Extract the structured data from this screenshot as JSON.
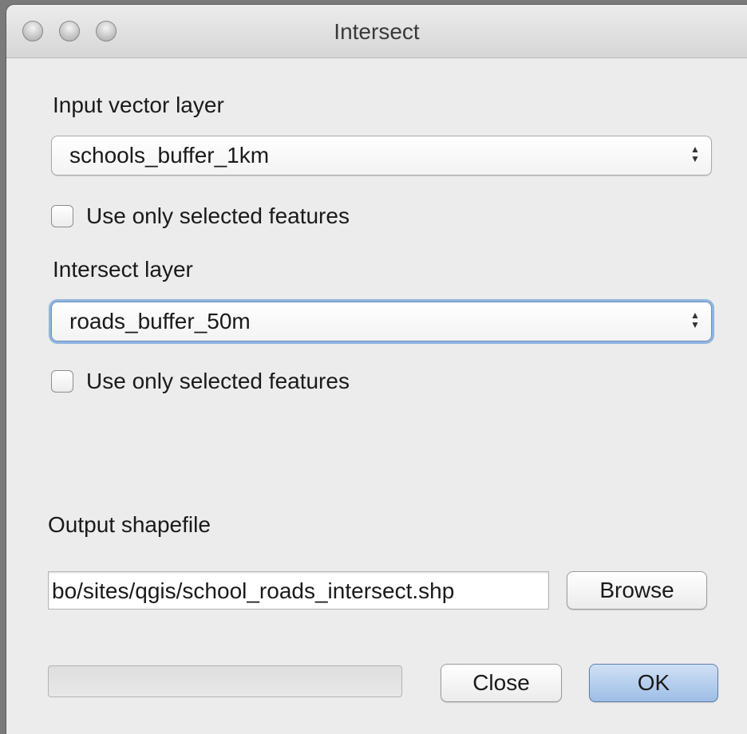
{
  "window": {
    "title": "Intersect"
  },
  "input_layer": {
    "label": "Input vector layer",
    "selected": "schools_buffer_1km",
    "use_selected_label": "Use only selected features",
    "use_selected_checked": false
  },
  "intersect_layer": {
    "label": "Intersect layer",
    "selected": "roads_buffer_50m",
    "use_selected_label": "Use only selected features",
    "use_selected_checked": false
  },
  "output": {
    "label": "Output shapefile",
    "path": "bo/sites/qgis/school_roads_intersect.shp",
    "browse_label": "Browse"
  },
  "footer": {
    "progress": 0,
    "close_label": "Close",
    "ok_label": "OK"
  }
}
